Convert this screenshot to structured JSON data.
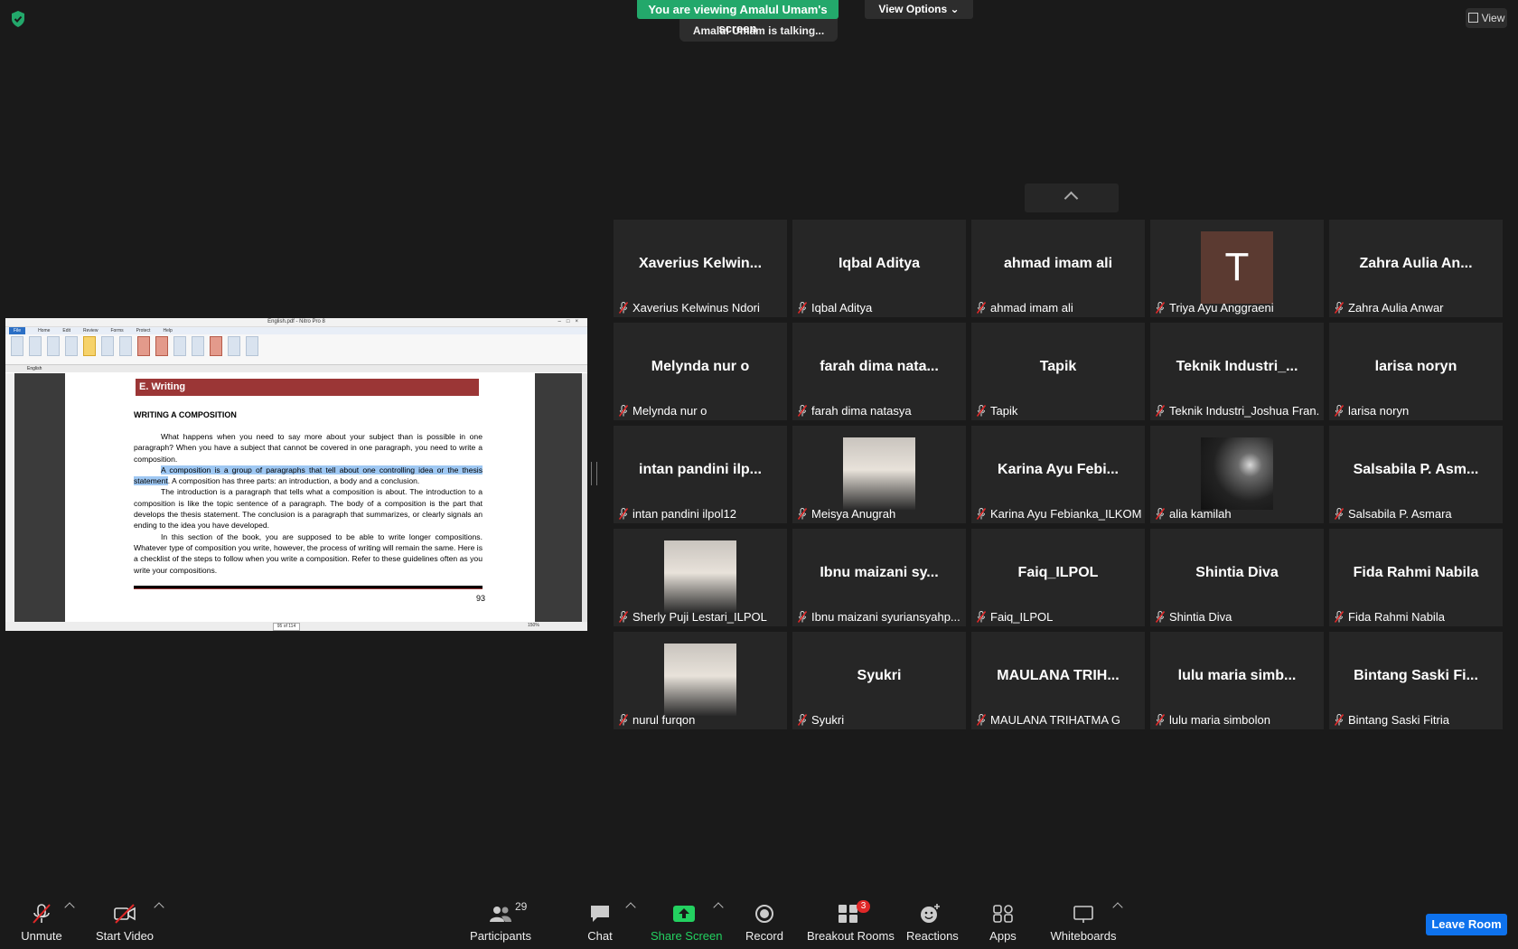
{
  "top": {
    "banner": "You are viewing Amalul Umam's screen",
    "view_options": "View Options",
    "talking": "Amalul Umam is talking...",
    "view_button": "View"
  },
  "shared_screen": {
    "window_title": "English.pdf - Nitro Pro 8",
    "menu": [
      "File",
      "Home",
      "Edit",
      "Review",
      "Forms",
      "Protect",
      "Help"
    ],
    "doc_tab": "English",
    "section_title": "E. Writing",
    "heading": "WRITING A COMPOSITION",
    "para1": "What happens when you need to say more about your subject than is possible in one paragraph? When you have a subject that cannot be covered in one paragraph, you need to write a composition.",
    "para2_highlight": "A composition is a group of paragraphs that tell about one controlling idea or the thesis statement",
    "para2_rest": ". A composition has three parts: an introduction, a body and a conclusion.",
    "para3": "The introduction is a paragraph that tells what a composition is about. The introduction to a composition is like the topic sentence of a paragraph. The body of a composition is the part that develops the thesis statement. The conclusion is a paragraph that summarizes, or clearly signals an ending to the idea you have developed.",
    "para4": "In this section of the book, you are supposed to be able to write longer compositions. Whatever type of composition you write, however, the process of writing will remain the same. Here is a checklist of the steps to follow when you write a composition. Refer to these guidelines often as you write your compositions.",
    "page_number": "93",
    "page_indicator": "95 of 114",
    "zoom": "150%"
  },
  "participants": [
    {
      "big": "Xaverius Kelwin...",
      "name": "Xaverius Kelwinus Ndori"
    },
    {
      "big": "Iqbal Aditya",
      "name": "Iqbal Aditya"
    },
    {
      "big": "ahmad imam ali",
      "name": "ahmad imam ali"
    },
    {
      "big": "T",
      "name": "Triya Ayu Anggraeni",
      "avatar": "letter"
    },
    {
      "big": "Zahra Aulia An...",
      "name": "Zahra Aulia Anwar"
    },
    {
      "big": "Melynda nur o",
      "name": "Melynda nur o"
    },
    {
      "big": "farah dima nata...",
      "name": "farah dima natasya"
    },
    {
      "big": "Tapik",
      "name": "Tapik"
    },
    {
      "big": "Teknik Industri_...",
      "name": "Teknik Industri_Joshua Fran..."
    },
    {
      "big": "larisa noryn",
      "name": "larisa noryn"
    },
    {
      "big": "intan pandini ilp...",
      "name": "intan pandini ilpol12"
    },
    {
      "big": "",
      "name": "Meisya Anugrah",
      "avatar": "photo"
    },
    {
      "big": "Karina Ayu Febi...",
      "name": "Karina Ayu Febianka_ILKOM"
    },
    {
      "big": "",
      "name": "alia kamilah",
      "avatar": "dark-photo"
    },
    {
      "big": "Salsabila P. Asm...",
      "name": "Salsabila P. Asmara"
    },
    {
      "big": "",
      "name": "Sherly Puji Lestari_ILPOL",
      "avatar": "photo"
    },
    {
      "big": "Ibnu maizani sy...",
      "name": "Ibnu maizani syuriansyahp..."
    },
    {
      "big": "Faiq_ILPOL",
      "name": "Faiq_ILPOL"
    },
    {
      "big": "Shintia Diva",
      "name": "Shintia Diva"
    },
    {
      "big": "Fida Rahmi Nabila",
      "name": "Fida Rahmi Nabila"
    },
    {
      "big": "",
      "name": "nurul furqon",
      "avatar": "photo"
    },
    {
      "big": "Syukri",
      "name": "Syukri"
    },
    {
      "big": "MAULANA TRIH...",
      "name": "MAULANA TRIHATMA G"
    },
    {
      "big": "lulu maria simb...",
      "name": "lulu maria simbolon"
    },
    {
      "big": "Bintang Saski Fi...",
      "name": "Bintang Saski Fitria"
    }
  ],
  "toolbar": {
    "unmute": "Unmute",
    "start_video": "Start Video",
    "participants": "Participants",
    "participants_count": "29",
    "chat": "Chat",
    "share_screen": "Share Screen",
    "record": "Record",
    "breakout_rooms": "Breakout Rooms",
    "breakout_badge": "3",
    "reactions": "Reactions",
    "apps": "Apps",
    "whiteboards": "Whiteboards",
    "leave": "Leave Room"
  },
  "colors": {
    "accent_green": "#23a86b",
    "leave_blue": "#0e72ed",
    "muted_red": "#e02828"
  }
}
